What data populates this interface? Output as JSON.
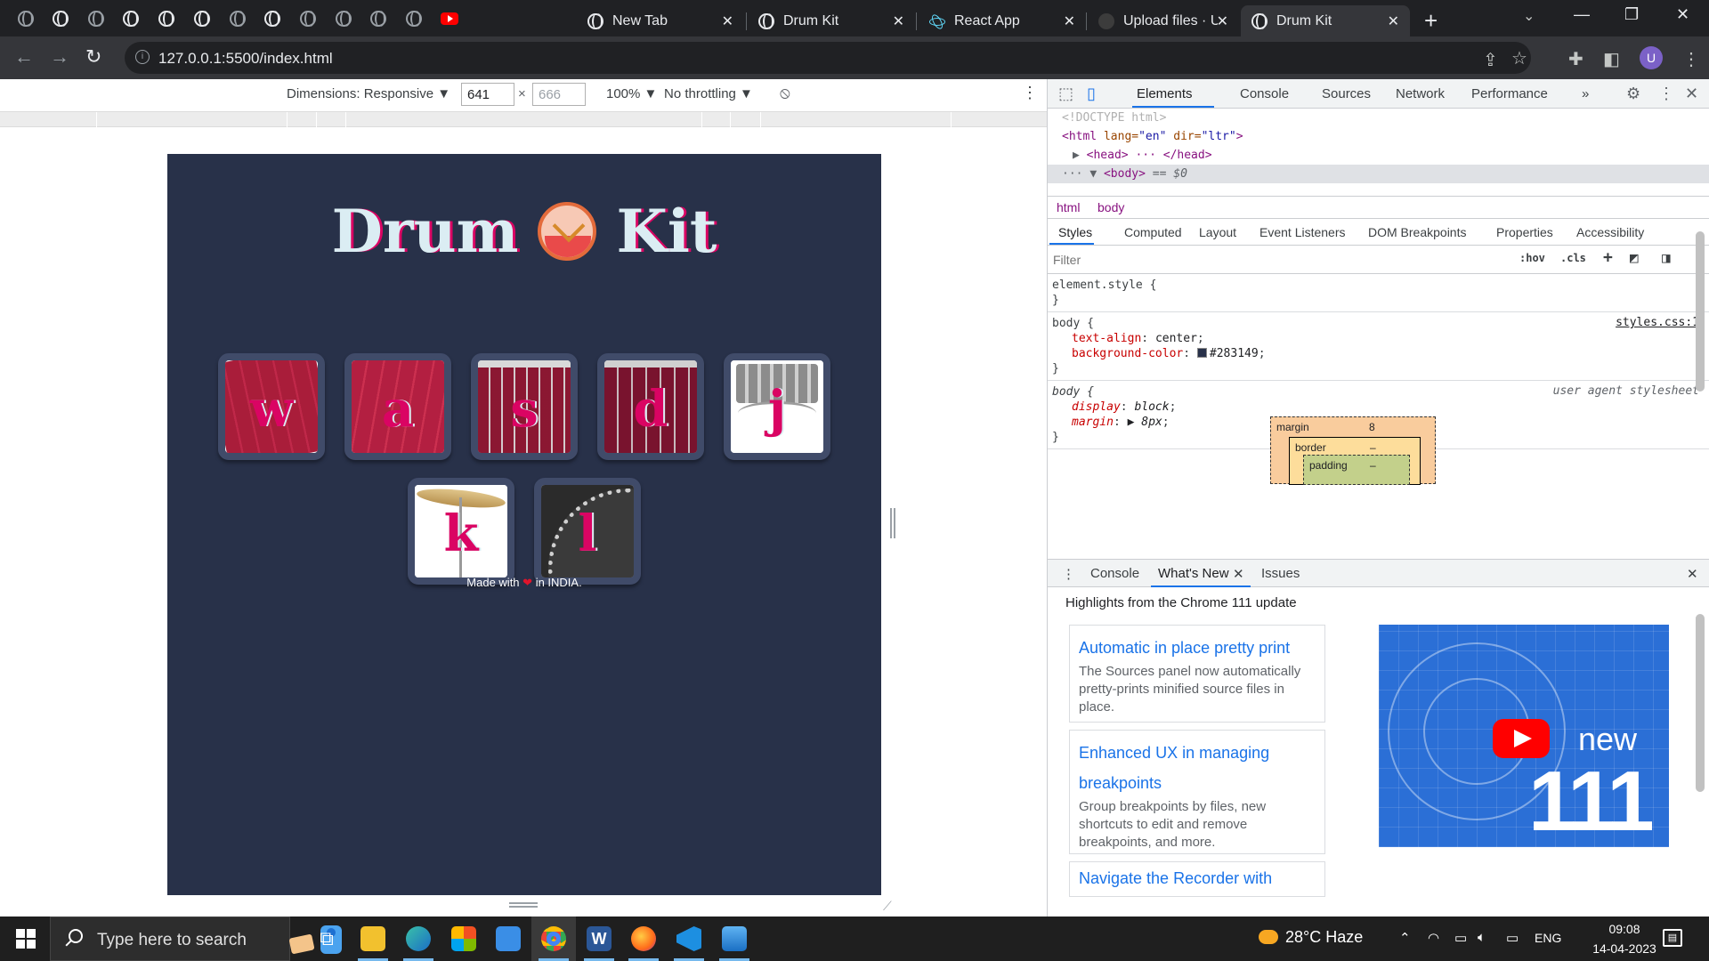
{
  "browser": {
    "tabs": [
      {
        "title": "New Tab",
        "favicon": "chrome-icon"
      },
      {
        "title": "Drum Kit",
        "favicon": "globe-icon"
      },
      {
        "title": "React App",
        "favicon": "react-icon"
      },
      {
        "title": "Upload files · Ur",
        "favicon": "github-icon"
      },
      {
        "title": "Drum Kit",
        "favicon": "globe-icon",
        "active": true
      }
    ],
    "tab_close": "✕",
    "new_tab": "+",
    "url": "127.0.0.1:5500/index.html",
    "profile_initial": "U"
  },
  "device_toolbar": {
    "dimensions_label": "Dimensions: Responsive ▼",
    "width": "641",
    "times": "×",
    "height": "666",
    "zoom": "100% ▼",
    "throttling": "No throttling ▼"
  },
  "page": {
    "title_left": "Drum",
    "title_right": "Kit",
    "background_color": "#283149",
    "drums": [
      {
        "key": "w",
        "art": "tom1"
      },
      {
        "key": "a",
        "art": "tom2"
      },
      {
        "key": "s",
        "art": "snare"
      },
      {
        "key": "d",
        "art": "bass"
      },
      {
        "key": "j",
        "art": "crash"
      },
      {
        "key": "k",
        "art": "kick"
      },
      {
        "key": "l",
        "art": "cymbal"
      }
    ],
    "footer_before": "Made with",
    "footer_heart": "❤",
    "footer_after": " in INDIA."
  },
  "devtools": {
    "tabs": [
      "Elements",
      "Console",
      "Sources",
      "Network",
      "Performance",
      "»"
    ],
    "dom": {
      "doctype": "<!DOCTYPE html>",
      "html_open_tag": "<html",
      "html_attr1_name": " lang=",
      "html_attr1_val": "\"en\"",
      "html_attr2_name": " dir=",
      "html_attr2_val": "\"ltr\"",
      "html_close_bracket": ">",
      "head_line": "<head> ··· </head>",
      "body_line": "<body>",
      "body_note": " == $0"
    },
    "breadcrumbs": [
      "html",
      "body"
    ],
    "sub_tabs": [
      "Styles",
      "Computed",
      "Layout",
      "Event Listeners",
      "DOM Breakpoints",
      "Properties",
      "Accessibility"
    ],
    "filter_placeholder": "Filter",
    "filter_hov": ":hov",
    "filter_cls": ".cls",
    "styles": {
      "element_style": "element.style {",
      "close_brace": "}",
      "rule1_selector": "body {",
      "rule1_origin": "styles.css:1",
      "rule1_prop1": "text-align",
      "rule1_val1": "center",
      "rule1_prop2": "background-color",
      "rule1_val2": "#283149",
      "rule2_selector": "body {",
      "rule2_origin": "user agent stylesheet",
      "rule2_prop1": "display",
      "rule2_val1": "block",
      "rule2_prop2": "margin",
      "rule2_val2": "▶ 8px"
    },
    "box_model": {
      "margin_label": "margin",
      "margin_value": "8",
      "border_label": "border",
      "border_value": "–",
      "padding_label": "padding",
      "padding_value": "–"
    },
    "drawer_tabs": [
      "Console",
      "What's New",
      "Issues"
    ],
    "whats_new": {
      "heading": "Highlights from the Chrome 111 update",
      "cards": [
        {
          "title": "Automatic in place pretty print",
          "desc": "The Sources panel now automatically pretty-prints minified source files in place."
        },
        {
          "title": "Enhanced UX in managing breakpoints",
          "desc": "Group breakpoints by files, new shortcuts to edit and remove breakpoints, and more."
        },
        {
          "title": "Navigate the Recorder with",
          "desc": ""
        }
      ],
      "video_new": "new",
      "video_version": "111"
    }
  },
  "taskbar": {
    "search_placeholder": "Type here to search",
    "apps": [
      "task-view",
      "file-explorer",
      "edge",
      "microsoft-store",
      "mail",
      "chrome",
      "word",
      "firefox",
      "vscode",
      "photos"
    ],
    "weather": "28°C  Haze",
    "language": "ENG",
    "time": "09:08",
    "date": "14-04-2023"
  }
}
